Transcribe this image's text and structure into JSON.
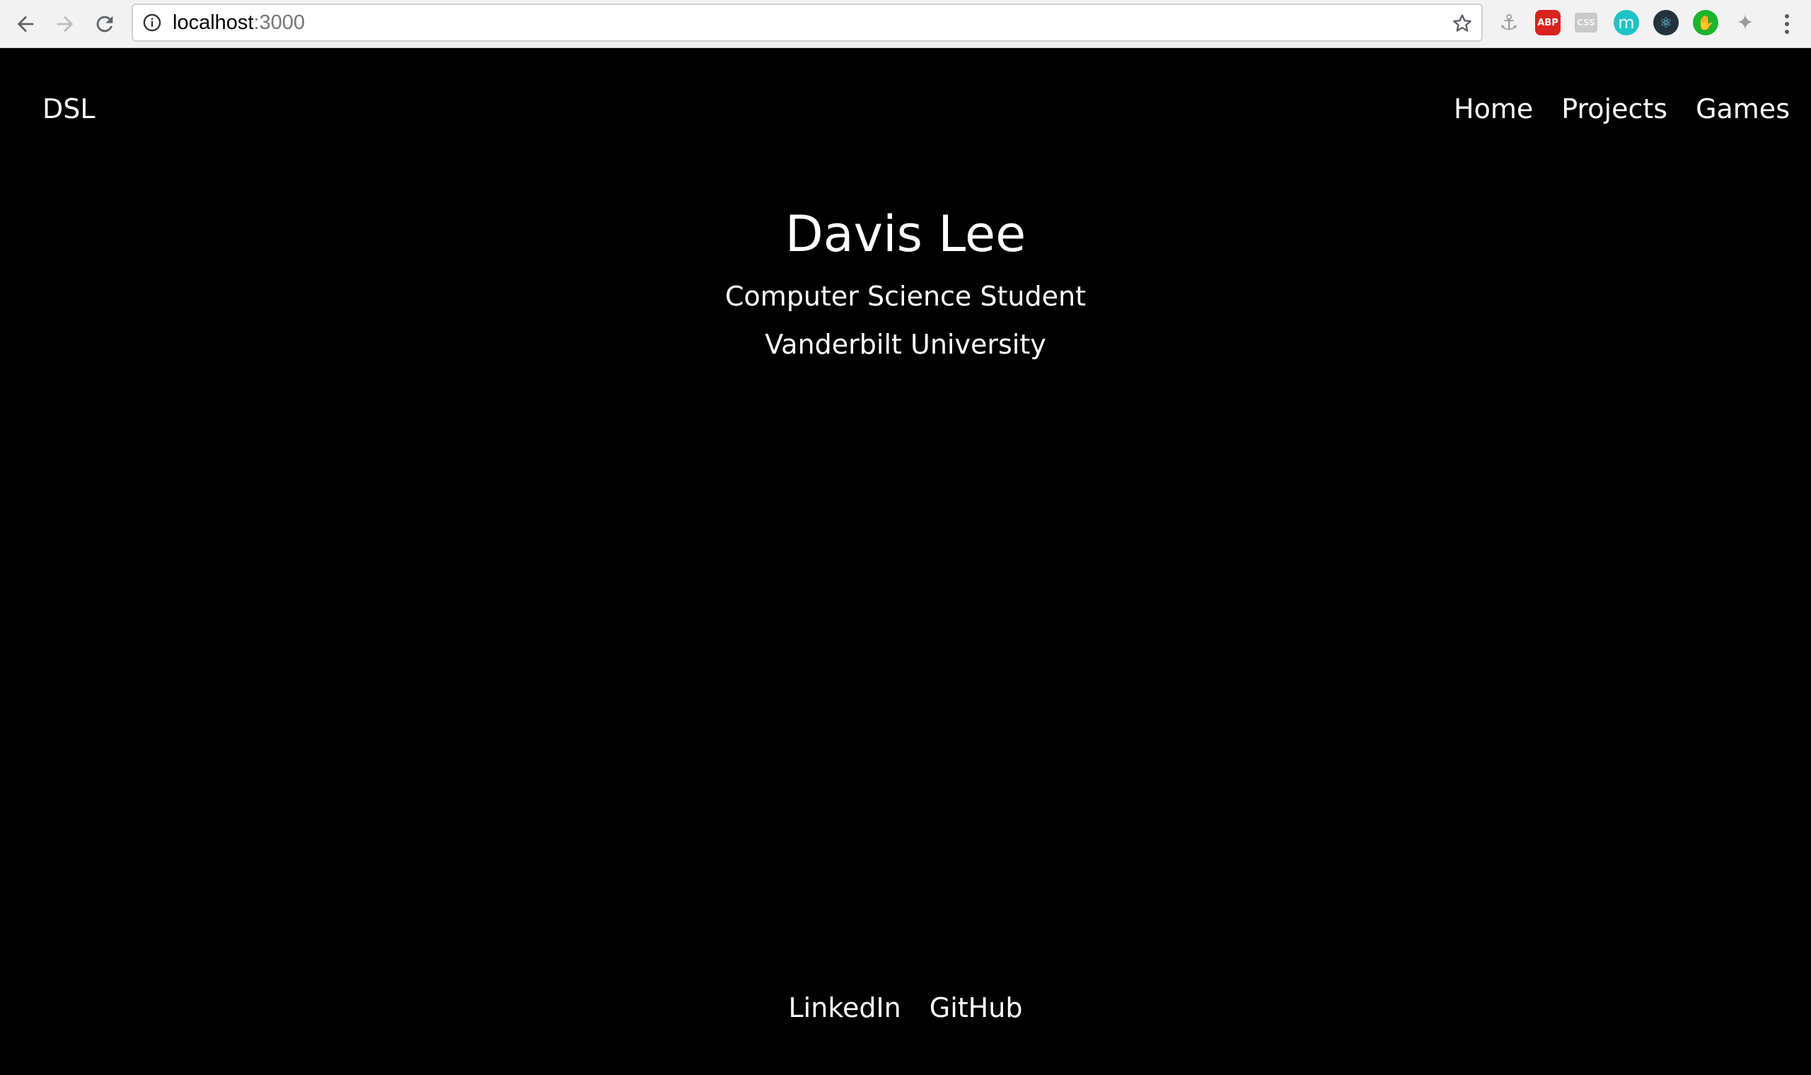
{
  "browser": {
    "url_host": "localhost",
    "url_port": ":3000",
    "extensions": [
      "anchor-icon",
      "adblock-plus-icon",
      "css-viewer-icon",
      "m-extension-icon",
      "react-devtools-icon",
      "green-extension-icon",
      "puzzle-icon"
    ],
    "abp_label": "ABP",
    "css_label": "CSS",
    "m_label": "m"
  },
  "nav": {
    "brand": "DSL",
    "items": [
      {
        "label": "Home"
      },
      {
        "label": "Projects"
      },
      {
        "label": "Games"
      }
    ]
  },
  "hero": {
    "name": "Davis Lee",
    "title": "Computer Science Student",
    "school": "Vanderbilt University"
  },
  "footer": {
    "links": [
      {
        "label": "LinkedIn"
      },
      {
        "label": "GitHub"
      }
    ]
  },
  "colors": {
    "background": "#000000",
    "text": "#ffffff",
    "chrome": "#f2f2f2"
  }
}
